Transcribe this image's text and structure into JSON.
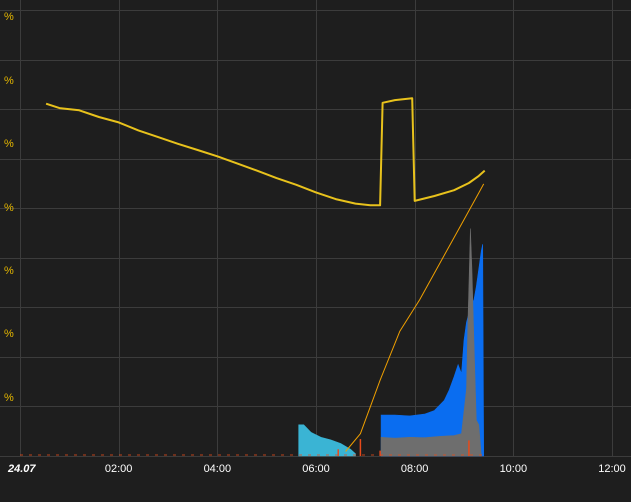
{
  "chart_data": {
    "type": "line",
    "colors": {
      "background": "#1e1e1e",
      "grid": "#3c3c3c",
      "y_tick_label": "#e6b800",
      "x_tick_label": "#ffffff",
      "series_yellow": "#e8c21c",
      "series_orange_thin": "#f0a000",
      "area_blue": "#0a6df0",
      "area_gray": "#6e6e6e",
      "area_cyan": "#3ab4d4",
      "spike_red": "#e84a1a"
    },
    "x_axis": {
      "tick_labels": [
        "24.07",
        "02:00",
        "04:00",
        "06:00",
        "08:00",
        "10:00",
        "12:00"
      ],
      "range_hours": [
        0,
        12
      ],
      "grid": true
    },
    "y_axis": {
      "tick_labels": [
        "%",
        "%",
        "%",
        "%",
        "%",
        "%",
        "%"
      ],
      "range_percent": [
        0,
        100
      ],
      "grid": true
    },
    "series": [
      {
        "kind": "line",
        "color_key": "series_yellow",
        "points": [
          [
            0.53,
            79
          ],
          [
            0.8,
            78
          ],
          [
            1.2,
            77.5
          ],
          [
            1.6,
            76
          ],
          [
            2.0,
            74.8
          ],
          [
            2.4,
            73
          ],
          [
            2.8,
            71.5
          ],
          [
            3.2,
            70
          ],
          [
            3.6,
            68.6
          ],
          [
            4.0,
            67.2
          ],
          [
            4.4,
            65.6
          ],
          [
            4.8,
            64
          ],
          [
            5.2,
            62.3
          ],
          [
            5.6,
            60.8
          ],
          [
            6.0,
            59.1
          ],
          [
            6.4,
            57.6
          ],
          [
            6.8,
            56.6
          ],
          [
            7.1,
            56.2
          ],
          [
            7.3,
            56.2
          ],
          [
            7.35,
            79.2
          ],
          [
            7.6,
            79.8
          ],
          [
            7.95,
            80.2
          ],
          [
            8.0,
            57.2
          ],
          [
            8.4,
            58.3
          ],
          [
            8.8,
            59.6
          ],
          [
            9.1,
            61.2
          ],
          [
            9.3,
            62.8
          ],
          [
            9.42,
            64
          ]
        ]
      },
      {
        "kind": "line",
        "color_key": "series_orange_thin",
        "points": [
          [
            6.6,
            1
          ],
          [
            6.9,
            5
          ],
          [
            7.3,
            17
          ],
          [
            7.7,
            28
          ],
          [
            8.1,
            35
          ],
          [
            8.5,
            43
          ],
          [
            8.9,
            51
          ],
          [
            9.3,
            59
          ],
          [
            9.4,
            61
          ]
        ]
      },
      {
        "kind": "area",
        "color_key": "area_cyan",
        "points": [
          [
            5.65,
            0
          ],
          [
            5.65,
            7
          ],
          [
            5.75,
            7
          ],
          [
            5.9,
            5.3
          ],
          [
            6.1,
            4.2
          ],
          [
            6.3,
            3.6
          ],
          [
            6.5,
            2.8
          ],
          [
            6.7,
            1.5
          ],
          [
            6.8,
            0.5
          ],
          [
            6.8,
            0
          ]
        ]
      },
      {
        "kind": "area",
        "color_key": "area_blue",
        "points": [
          [
            7.32,
            0
          ],
          [
            7.32,
            9.2
          ],
          [
            7.6,
            9.2
          ],
          [
            7.9,
            9.0
          ],
          [
            8.2,
            9.4
          ],
          [
            8.4,
            10.2
          ],
          [
            8.6,
            12.5
          ],
          [
            8.7,
            14.8
          ],
          [
            8.8,
            17.8
          ],
          [
            8.88,
            20.5
          ],
          [
            8.95,
            18.5
          ],
          [
            9.0,
            26
          ],
          [
            9.05,
            30
          ],
          [
            9.1,
            32
          ],
          [
            9.15,
            34
          ],
          [
            9.2,
            35
          ],
          [
            9.25,
            38
          ],
          [
            9.3,
            42
          ],
          [
            9.35,
            46
          ],
          [
            9.38,
            47.5
          ],
          [
            9.4,
            0
          ]
        ]
      },
      {
        "kind": "area",
        "color_key": "area_gray",
        "points": [
          [
            7.32,
            0
          ],
          [
            7.32,
            4.2
          ],
          [
            7.6,
            4.0
          ],
          [
            7.9,
            4.2
          ],
          [
            8.2,
            4.1
          ],
          [
            8.5,
            4.4
          ],
          [
            8.8,
            4.6
          ],
          [
            8.95,
            5.0
          ],
          [
            9.0,
            10
          ],
          [
            9.05,
            15
          ],
          [
            9.08,
            30
          ],
          [
            9.1,
            38
          ],
          [
            9.13,
            51
          ],
          [
            9.16,
            42
          ],
          [
            9.2,
            26
          ],
          [
            9.25,
            8
          ],
          [
            9.3,
            7
          ],
          [
            9.35,
            0
          ]
        ]
      },
      {
        "kind": "spikes",
        "color_key": "spike_red",
        "points": [
          [
            6.45,
            1.5
          ],
          [
            6.9,
            3.8
          ],
          [
            7.3,
            1.2
          ],
          [
            9.1,
            3.5
          ]
        ]
      }
    ]
  }
}
